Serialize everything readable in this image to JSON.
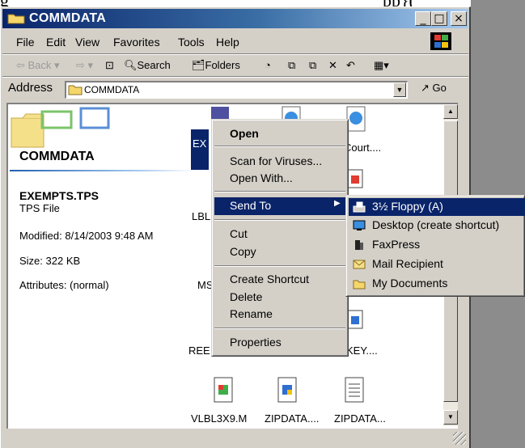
{
  "window": {
    "title": "COMMDATA",
    "caption_buttons": {
      "minimize": "_",
      "maximize": "□",
      "close": "×"
    }
  },
  "menubar": {
    "items": [
      "File",
      "Edit",
      "View",
      "Favorites",
      "Tools",
      "Help"
    ]
  },
  "toolbar": {
    "back": "Back",
    "search": "Search",
    "folders": "Folders"
  },
  "address": {
    "label": "Address",
    "value": "COMMDATA",
    "go": "Go"
  },
  "info_panel": {
    "folder_name": "COMMDATA",
    "file_name": "EXEMPTS.TPS",
    "file_type": "TPS File",
    "modified": "Modified: 8/14/2003 9:48 AM",
    "size": "Size: 322 KB",
    "attributes": "Attributes: (normal)"
  },
  "files": {
    "selected_partial": "EX",
    "court_partial": "Court....",
    "lbl_partial": "LBL",
    "ms_partial": "MS",
    "ree_partial": "REE",
    "key_partial": "KEY....",
    "row3": [
      "VLBL3X9.M",
      "ZIPDATA....",
      "ZIPDATA..."
    ]
  },
  "context_menu": {
    "items": [
      "Open",
      "Scan for Viruses...",
      "Open With...",
      "Send To",
      "Cut",
      "Copy",
      "Create Shortcut",
      "Delete",
      "Rename",
      "Properties"
    ],
    "highlighted": "Send To"
  },
  "send_to_menu": {
    "items": [
      "3½ Floppy (A)",
      "Desktop (create shortcut)",
      "FaxPress",
      "Mail Recipient",
      "My Documents"
    ],
    "highlighted": "3½ Floppy (A)"
  },
  "colors": {
    "titlebar_start": "#0a246a",
    "titlebar_end": "#a6caf0",
    "highlight": "#0a246a",
    "face": "#d4d0c8"
  }
}
